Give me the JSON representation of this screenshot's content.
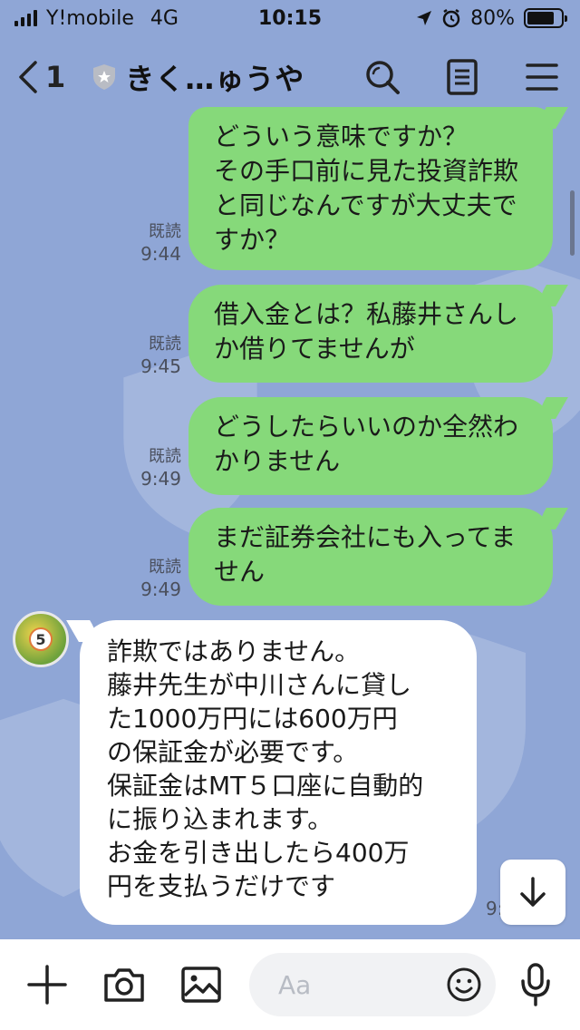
{
  "status_bar": {
    "carrier": "Y!mobile",
    "network": "4G",
    "time": "10:15",
    "battery": "80%",
    "battery_level": 0.8
  },
  "header": {
    "back_count": "1",
    "title": "きく…ゅうや",
    "icons": [
      "search-icon",
      "notes-icon",
      "menu-icon"
    ]
  },
  "messages": [
    {
      "side": "out",
      "lines": [
        "どういう意味ですか？",
        "その手口前に見た投資詐欺",
        "と同じなんですが大丈夫で",
        "すか？"
      ],
      "read": "既読",
      "time": "9:44"
    },
    {
      "side": "out",
      "lines": [
        "借入金とは？私藤井さんし",
        "か借りてませんが"
      ],
      "read": "既読",
      "time": "9:45"
    },
    {
      "side": "out",
      "lines": [
        "どうしたらいいのか全然わ",
        "かりません"
      ],
      "read": "既読",
      "time": "9:49"
    },
    {
      "side": "out",
      "lines": [
        "まだ証券会社にも入ってま",
        "せん"
      ],
      "read": "既読",
      "time": "9:49"
    },
    {
      "side": "in",
      "lines": [
        "詐欺ではありません。",
        "藤井先生が中川さんに貸し",
        "た1000万円には600万円",
        "の保証金が必要です。",
        "保証金はMT５口座に自動的",
        "に振り込まれます。",
        "お金を引き出したら400万",
        "円を支払うだけです"
      ],
      "avatar_badge": "5",
      "time_partial": "9:"
    }
  ],
  "input": {
    "placeholder": "Aa"
  },
  "colors": {
    "background": "#8fa6d6",
    "outgoing_bubble": "#86d97a",
    "incoming_bubble": "#ffffff"
  }
}
